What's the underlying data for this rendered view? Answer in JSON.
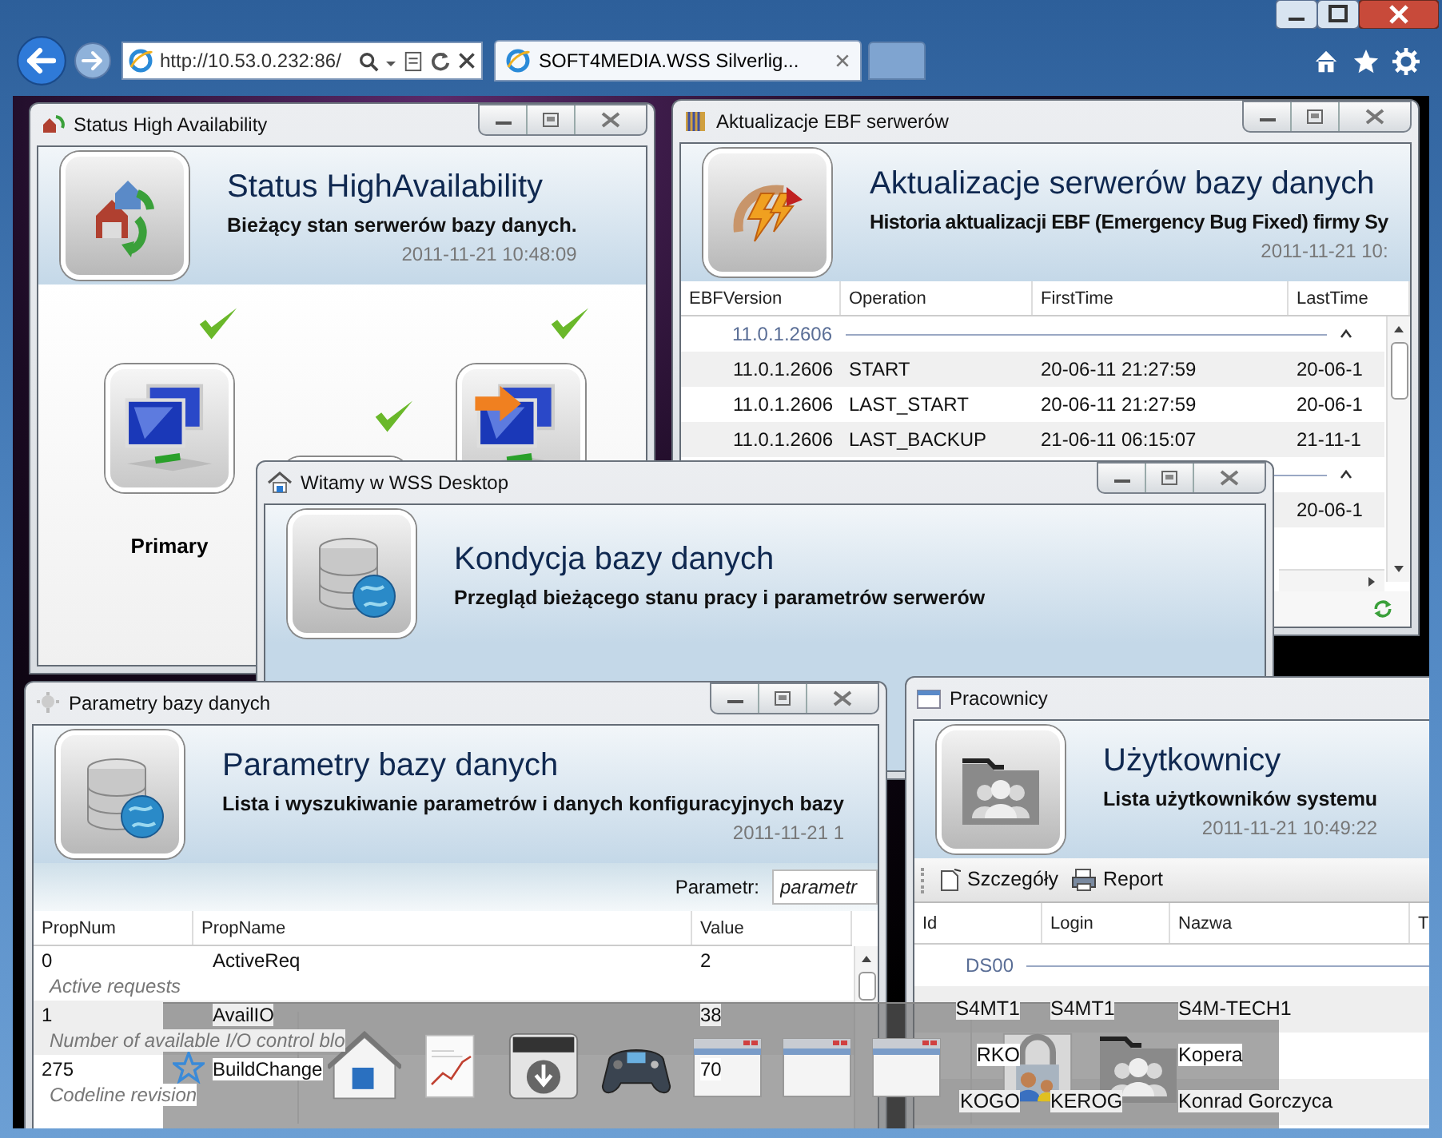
{
  "browser": {
    "address": "http://10.53.0.232:86/",
    "tabs": [
      {
        "title": "SOFT4MEDIA.WSS Silverlig...",
        "selected": true
      }
    ]
  },
  "windows": [
    {
      "kind": "status",
      "title": "Status High Availability",
      "heading": "Status HighAvailability",
      "subtitle": "Bieżący stan serwerów bazy danych.",
      "timestamp": "2011-11-21 10:48:09",
      "nodes": [
        {
          "label": "Primary",
          "ok": true
        },
        {
          "ok": true
        },
        {
          "ok": true
        }
      ]
    },
    {
      "kind": "updates",
      "title": "Aktualizacje EBF serwerów",
      "heading": "Aktualizacje serwerów bazy danych",
      "subtitle": "Historia aktualizacji EBF (Emergency Bug Fixed) firmy Sy",
      "timestamp": "2011-11-21 10:",
      "columns": [
        "EBFVersion",
        "Operation",
        "FirstTime",
        "LastTime"
      ],
      "rows": [
        {
          "kind": "group",
          "label": "11.0.1.2606",
          "expanded": true
        },
        {
          "kind": "row",
          "ebf_version": "11.0.1.2606",
          "operation": "START",
          "first_time": "20-06-11 21:27:59",
          "last_time": "20-06-1"
        },
        {
          "kind": "row",
          "ebf_version": "11.0.1.2606",
          "operation": "LAST_START",
          "first_time": "20-06-11 21:27:59",
          "last_time": "20-06-1"
        },
        {
          "kind": "row",
          "ebf_version": "11.0.1.2606",
          "operation": "LAST_BACKUP",
          "first_time": "21-06-11 06:15:07",
          "last_time": "21-11-1"
        },
        {
          "kind": "group",
          "expanded": true
        },
        {
          "kind": "row",
          "last_time": "20-06-1"
        }
      ]
    },
    {
      "kind": "welcome",
      "title": "Witamy w WSS Desktop",
      "heading": "Kondycja bazy danych",
      "subtitle": "Przegląd bieżącego stanu pracy i parametrów serwerów"
    },
    {
      "kind": "params",
      "title": "Parametry bazy danych",
      "heading": "Parametry bazy danych",
      "subtitle": "Lista i wyszukiwanie parametrów i danych konfiguracyjnych bazy",
      "timestamp": "2011-11-21 1",
      "filter": {
        "label": "Parametr:",
        "placeholder": "parametr"
      },
      "columns": [
        "PropNum",
        "PropName",
        "Value"
      ],
      "rows": [
        {
          "num": "0",
          "name": "ActiveReq",
          "value": "2",
          "description": "Active requests"
        },
        {
          "num": "1",
          "name": "AvailIO",
          "value": "38",
          "description": "Number of available I/O control blo"
        },
        {
          "num": "275",
          "name": "BuildChange",
          "value": "70",
          "description": "Codeline revision"
        }
      ]
    },
    {
      "kind": "users",
      "title": "Pracownicy",
      "heading": "Użytkownicy",
      "subtitle": "Lista użytkowników systemu",
      "timestamp": "2011-11-21 10:49:22",
      "toolbar": [
        "Szczegóły",
        "Report"
      ],
      "columns": [
        "Id",
        "Login",
        "Nazwa",
        "T"
      ],
      "rows": [
        {
          "kind": "group",
          "label": "DS00"
        },
        {
          "kind": "row",
          "id": "S4MT1",
          "login": "S4MT1",
          "name": "S4M-TECH1"
        },
        {
          "kind": "row",
          "id": "RKO",
          "name": "Kopera"
        },
        {
          "kind": "row",
          "id": "KOGO",
          "login": "KEROG",
          "name": "Konrad Gorczyca"
        }
      ]
    }
  ]
}
